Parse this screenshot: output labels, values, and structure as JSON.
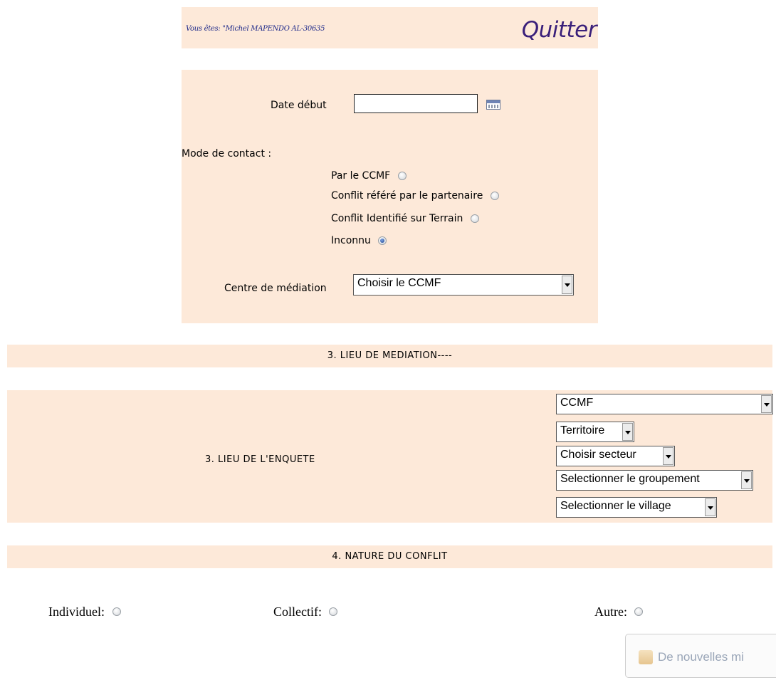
{
  "header": {
    "user_label": "Vous êtes: \"Michel MAPENDO AL-30635",
    "quit_label": "Quitter"
  },
  "form": {
    "date_label": "Date début",
    "date_value": "",
    "calendar_icon": "calendar-icon",
    "contact_label": "Mode de contact :",
    "contact_options": [
      {
        "label": "Par le CCMF",
        "checked": false
      },
      {
        "label": "Conflit référé par le partenaire",
        "checked": false
      },
      {
        "label": "Conflit Identifié sur Terrain",
        "checked": false
      },
      {
        "label": "Inconnu",
        "checked": true
      }
    ],
    "centre_label": "Centre de médiation",
    "centre_value": "Choisir le CCMF"
  },
  "sections": {
    "lieu_mediation": "3. LIEU DE MEDIATION----",
    "lieu_enquete": "3. LIEU DE L'ENQUETE",
    "nature_conflit": "4. NATURE DU CONFLIT"
  },
  "enquete_selects": {
    "ccmf": "CCMF",
    "territoire": "Territoire",
    "secteur": "Choisir secteur",
    "groupement": "Selectionner le groupement",
    "village": "Selectionner le village"
  },
  "nature": {
    "individuel": "Individuel:",
    "collectif": "Collectif:",
    "autre": "Autre:"
  },
  "toast": {
    "text": "De nouvelles mi"
  },
  "colors": {
    "panel": "#fde9d9",
    "quit": "#3a1f7a",
    "user": "#1f2a8a"
  }
}
